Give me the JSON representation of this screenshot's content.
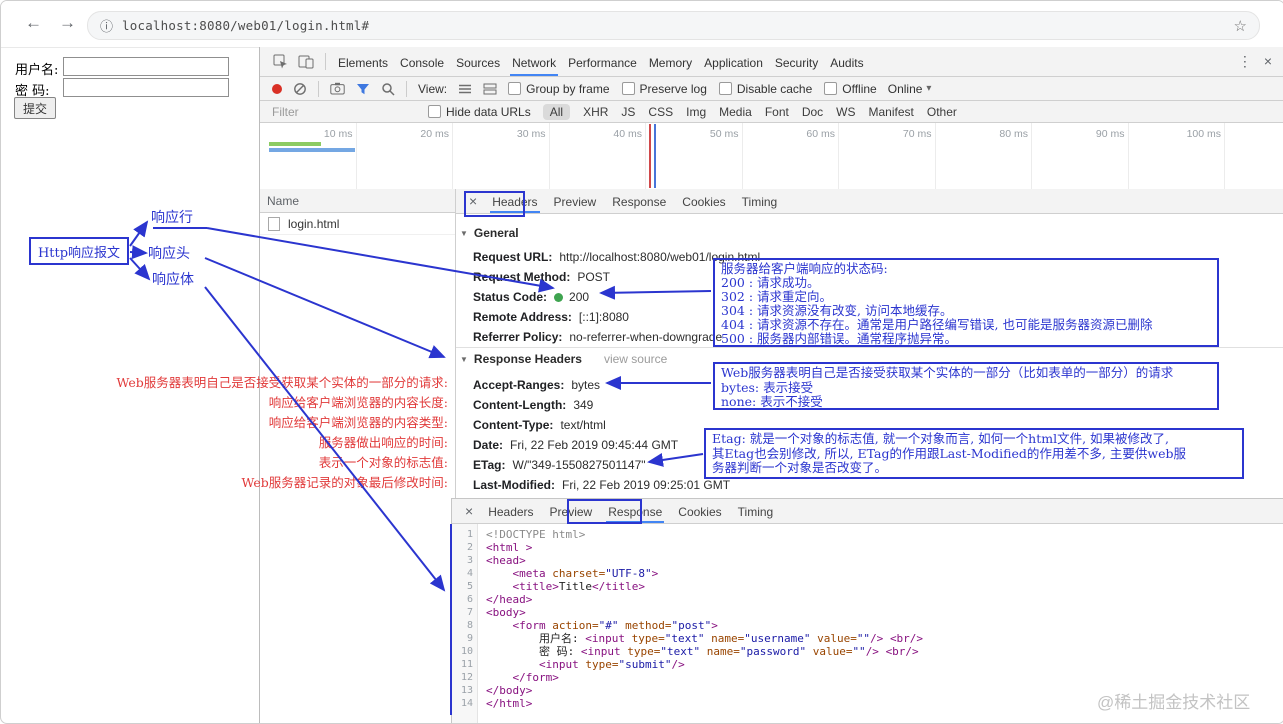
{
  "browser": {
    "url": "localhost:8080/web01/login.html#"
  },
  "icons": {
    "back": "←",
    "forward": "→",
    "page_info": "ⓘ",
    "bookmark_star": "☆",
    "overflow_menu": "⋮",
    "devtools_close": "×",
    "dropdown_caret": "▾",
    "section_caret": "▼"
  },
  "page_form": {
    "username_label": "用户名:",
    "password_label": "密 码:",
    "submit_button": "提交"
  },
  "devtools": {
    "main_tabs": [
      "Elements",
      "Console",
      "Sources",
      "Network",
      "Performance",
      "Memory",
      "Application",
      "Security",
      "Audits"
    ],
    "active_main_tab": "Network",
    "toolbar": {
      "view_label": "View:",
      "checkboxes": [
        "Group by frame",
        "Preserve log",
        "Disable cache",
        "Offline"
      ],
      "throttling_select": "Online"
    },
    "filter_bar": {
      "filter_placeholder": "Filter",
      "hide_data_urls_label": "Hide data URLs",
      "type_filters": [
        "All",
        "XHR",
        "JS",
        "CSS",
        "Img",
        "Media",
        "Font",
        "Doc",
        "WS",
        "Manifest",
        "Other"
      ],
      "active_type_filter": "All"
    },
    "timeline_ticks": [
      "10 ms",
      "20 ms",
      "30 ms",
      "40 ms",
      "50 ms",
      "60 ms",
      "70 ms",
      "80 ms",
      "90 ms",
      "100 ms"
    ],
    "request_list": {
      "name_column_header": "Name",
      "rows": [
        {
          "name": "login.html"
        }
      ]
    },
    "headers_pane": {
      "close_icon": "×",
      "tabs": [
        "Headers",
        "Preview",
        "Response",
        "Cookies",
        "Timing"
      ],
      "active_tab": "Headers",
      "general_section": {
        "title": "General",
        "rows": [
          {
            "name": "Request URL:",
            "value": "http://localhost:8080/web01/login.html"
          },
          {
            "name": "Request Method:",
            "value": "POST"
          },
          {
            "name": "Status Code:",
            "value": "200",
            "dot": "#3fa450"
          },
          {
            "name": "Remote Address:",
            "value": "[::1]:8080"
          },
          {
            "name": "Referrer Policy:",
            "value": "no-referrer-when-downgrade"
          }
        ]
      },
      "response_headers_section": {
        "title": "Response Headers",
        "view_source_label": "view source",
        "rows": [
          {
            "name": "Accept-Ranges:",
            "value": "bytes"
          },
          {
            "name": "Content-Length:",
            "value": "349"
          },
          {
            "name": "Content-Type:",
            "value": "text/html"
          },
          {
            "name": "Date:",
            "value": "Fri, 22 Feb 2019 09:45:44 GMT"
          },
          {
            "name": "ETag:",
            "value": "W/\"349-1550827501147\""
          },
          {
            "name": "Last-Modified:",
            "value": "Fri, 22 Feb 2019 09:25:01 GMT"
          }
        ]
      }
    },
    "response_pane": {
      "close_icon": "×",
      "tabs": [
        "Headers",
        "Preview",
        "Response",
        "Cookies",
        "Timing"
      ],
      "active_tab": "Response",
      "code_lines": [
        {
          "n": 1,
          "tokens": [
            [
              "doc",
              "<!DOCTYPE html>"
            ]
          ]
        },
        {
          "n": 2,
          "tokens": [
            [
              "tag",
              "<html >"
            ]
          ]
        },
        {
          "n": 3,
          "tokens": [
            [
              "tag",
              "<head>"
            ]
          ]
        },
        {
          "n": 4,
          "tokens": [
            [
              "txt",
              "    "
            ],
            [
              "tag",
              "<meta "
            ],
            [
              "attr",
              "charset="
            ],
            [
              "str",
              "\"UTF-8\""
            ],
            [
              "tag",
              ">"
            ]
          ]
        },
        {
          "n": 5,
          "tokens": [
            [
              "txt",
              "    "
            ],
            [
              "tag",
              "<title>"
            ],
            [
              "txt",
              "Title"
            ],
            [
              "tag",
              "</title>"
            ]
          ]
        },
        {
          "n": 6,
          "tokens": [
            [
              "tag",
              "</head>"
            ]
          ]
        },
        {
          "n": 7,
          "tokens": [
            [
              "tag",
              "<body>"
            ]
          ]
        },
        {
          "n": 8,
          "tokens": [
            [
              "txt",
              "    "
            ],
            [
              "tag",
              "<form "
            ],
            [
              "attr",
              "action="
            ],
            [
              "str",
              "\"#\""
            ],
            [
              "attr",
              " method="
            ],
            [
              "str",
              "\"post\""
            ],
            [
              "tag",
              ">"
            ]
          ]
        },
        {
          "n": 9,
          "tokens": [
            [
              "txt",
              "        用户名: "
            ],
            [
              "tag",
              "<input "
            ],
            [
              "attr",
              "type="
            ],
            [
              "str",
              "\"text\""
            ],
            [
              "attr",
              " name="
            ],
            [
              "str",
              "\"username\""
            ],
            [
              "attr",
              " value="
            ],
            [
              "str",
              "\"\""
            ],
            [
              "tag",
              "/>"
            ],
            [
              "txt",
              " "
            ],
            [
              "tag",
              "<br/>"
            ]
          ]
        },
        {
          "n": 10,
          "tokens": [
            [
              "txt",
              "        密 码: "
            ],
            [
              "tag",
              "<input "
            ],
            [
              "attr",
              "type="
            ],
            [
              "str",
              "\"text\""
            ],
            [
              "attr",
              " name="
            ],
            [
              "str",
              "\"password\""
            ],
            [
              "attr",
              " value="
            ],
            [
              "str",
              "\"\""
            ],
            [
              "tag",
              "/>"
            ],
            [
              "txt",
              " "
            ],
            [
              "tag",
              "<br/>"
            ]
          ]
        },
        {
          "n": 11,
          "tokens": [
            [
              "txt",
              "        "
            ],
            [
              "tag",
              "<input "
            ],
            [
              "attr",
              "type="
            ],
            [
              "str",
              "\"submit\""
            ],
            [
              "tag",
              "/>"
            ]
          ]
        },
        {
          "n": 12,
          "tokens": [
            [
              "txt",
              "    "
            ],
            [
              "tag",
              "</form>"
            ]
          ]
        },
        {
          "n": 13,
          "tokens": [
            [
              "tag",
              "</body>"
            ]
          ]
        },
        {
          "n": 14,
          "tokens": [
            [
              "tag",
              "</html>"
            ]
          ]
        }
      ]
    }
  },
  "annotations": {
    "label_box": "Http响应报文",
    "pointer_labels": [
      "响应行",
      "响应头",
      "响应体"
    ],
    "red_notes": [
      "Web服务器表明自己是否接受获取某个实体的一部分的请求:",
      "响应给客户端浏览器的内容长度:",
      "响应给客户端浏览器的内容类型:",
      "服务器做出响应的时间:",
      "表示一个对象的标志值:",
      "Web服务器记录的对象最后修改时间:"
    ],
    "status_code_box_lines": [
      "服务器给客户端响应的状态码:",
      "200 : 请求成功。",
      "302 : 请求重定向。",
      "304 : 请求资源没有改变, 访问本地缓存。",
      "404 : 请求资源不存在。通常是用户路径编写错误, 也可能是服务器资源已删除",
      "500 : 服务器内部错误。通常程序抛异常。"
    ],
    "accept_ranges_box_lines": [
      "Web服务器表明自己是否接受获取某个实体的一部分（比如表单的一部分）的请求",
      "bytes: 表示接受",
      "none: 表示不接受"
    ],
    "etag_box_lines": [
      "Etag: 就是一个对象的标志值, 就一个对象而言, 如何一个html文件, 如果被修改了,",
      "其Etag也会别修改, 所以, ETag的作用跟Last-Modified的作用差不多, 主要供web服",
      "务器判断一个对象是否改变了。"
    ]
  },
  "watermark": "@稀土掘金技术社区"
}
